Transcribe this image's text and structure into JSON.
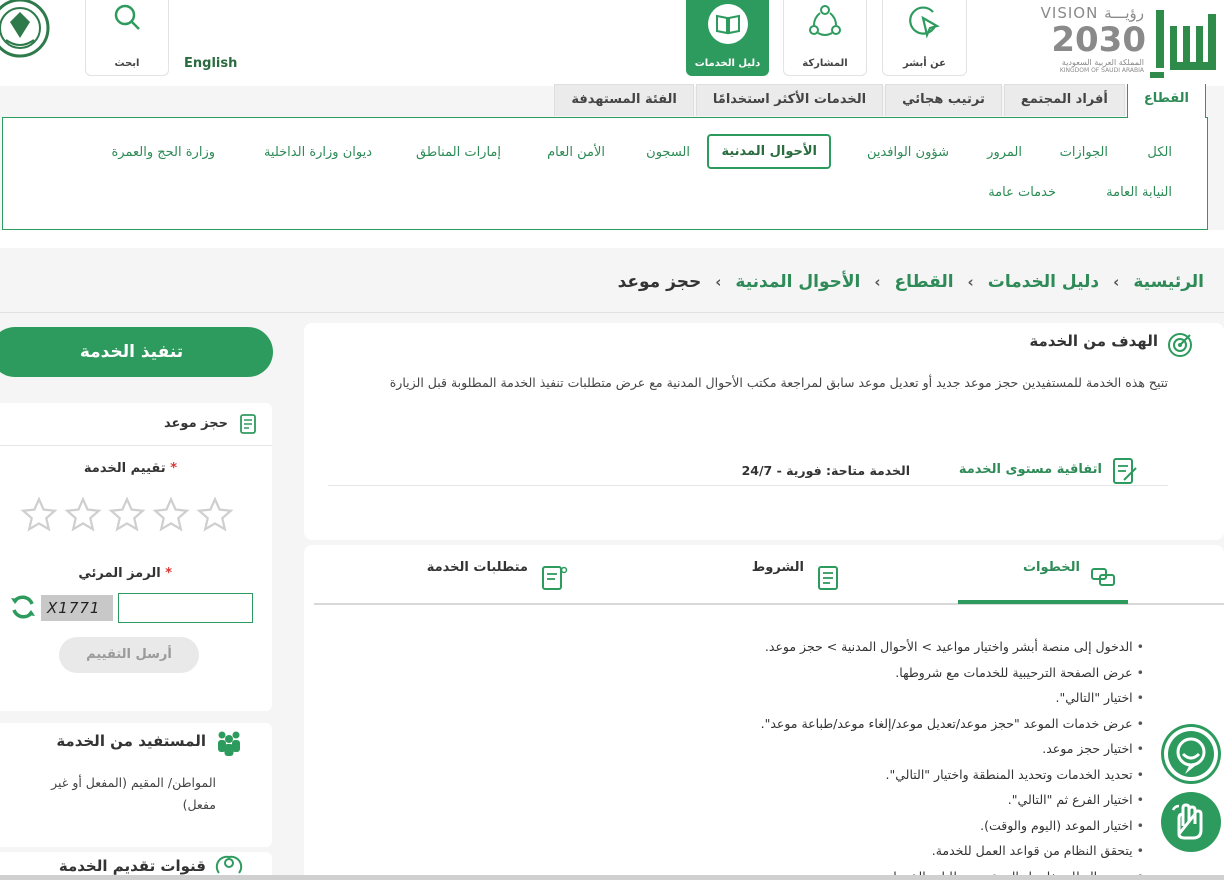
{
  "header": {
    "english": "English",
    "search": "ابحث",
    "about": "عن أبشر",
    "participation": "المشاركة",
    "services_guide": "دليل الخدمات",
    "vision": {
      "word": "VISION رؤيـــة",
      "year": "2030",
      "kingdom_ar": "المملكة العربية السعودية",
      "kingdom_en": "KINGDOM OF SAUDI ARABIA"
    }
  },
  "sector_tabs": [
    "القطاع",
    "أفراد المجتمع",
    "ترتيب هجائي",
    "الخدمات الأكثر استخدامًا",
    "الفئة المستهدفة"
  ],
  "sectors": [
    "الكل",
    "الجوازات",
    "المرور",
    "شؤون الوافدين",
    "الأحوال المدنية",
    "السجون",
    "الأمن العام",
    "إمارات المناطق",
    "ديوان وزارة الداخلية",
    "وزارة الحج والعمرة",
    "النيابة العامة",
    "خدمات عامة"
  ],
  "breadcrumb": [
    "الرئيسية",
    "دليل الخدمات",
    "القطاع",
    "الأحوال المدنية",
    "حجز موعد"
  ],
  "goal": {
    "title": "الهدف من الخدمة",
    "text": "تتيح هذه الخدمة للمستفيدين حجز موعد جديد أو تعديل موعد سابق لمراجعة مكتب الأحوال المدنية مع عرض متطلبات تنفيذ الخدمة المطلوبة قبل الزيارة",
    "sla": "اتفاقية مستوى الخدمة",
    "availability": "الخدمة متاحة: فورية - 24/7"
  },
  "tabs": {
    "steps": "الخطوات",
    "conditions": "الشروط",
    "requirements": "متطلبات الخدمة"
  },
  "steps": [
    "الدخول إلى منصة أبشر واختيار مواعيد > الأحوال المدنية > حجز موعد.",
    "عرض الصفحة الترحيبية للخدمات مع شروطها.",
    "اختيار \"التالي\".",
    "عرض خدمات الموعد \"حجز موعد/تعديل موعد/إلغاء موعد/طباعة موعد\".",
    "اختيار حجز موعد.",
    "تحديد الخدمات وتحديد المنطقة واختيار \"التالي\".",
    "اختيار الفرع ثم \"التالي\".",
    "اختيار الموعد (اليوم والوقت).",
    "يتحقق النظام من قواعد العمل للخدمة.",
    "يعرض النظام تفاصيل الموعد ومتطلبات الخدمات."
  ],
  "sidebar": {
    "execute": "تنفيذ الخدمة",
    "service_name": "حجز موعد",
    "rating_label": "تقييم الخدمة",
    "required_mark": "*",
    "rating_value": 0,
    "rating_max": 5,
    "captcha_label": "الرمز المرئي",
    "captcha_text": "X1771",
    "send": "أرسل التقييم",
    "beneficiary_title": "المستفيد من الخدمة",
    "beneficiary_text": "المواطن/ المقيم (المفعل أو غير مفعل)",
    "channels_title": "قنوات تقديم الخدمة"
  },
  "colors": {
    "primary": "#2e9b5e",
    "primary_dark": "#2a6b3f",
    "text": "#333333"
  }
}
